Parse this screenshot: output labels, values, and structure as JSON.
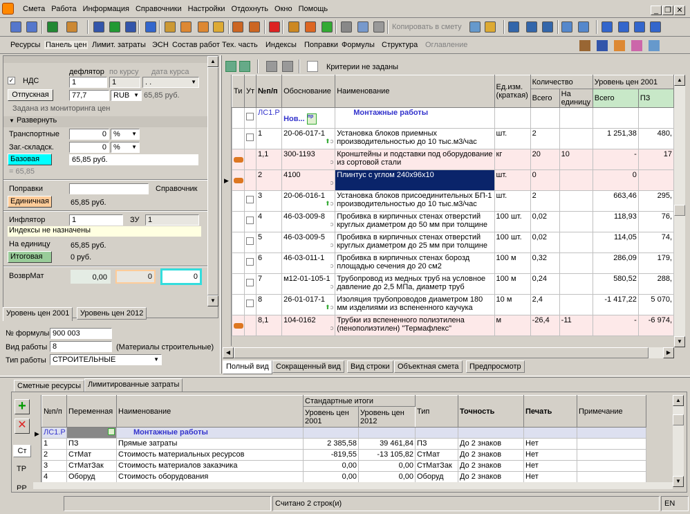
{
  "menu": [
    "Смета",
    "Работа",
    "Информация",
    "Справочники",
    "Настройки",
    "Отдохнуть",
    "Окно",
    "Помощь"
  ],
  "toolbar": {
    "copy_to_estimate": "Копировать в смету"
  },
  "toolbar_icons": [
    "add-row-icon",
    "insert-row-icon",
    "excel-icon",
    "find-icon",
    "save-icon",
    "refresh-icon",
    "undo-icon",
    "recalc-icon",
    "tools-icon",
    "people-icon",
    "house-icon",
    "comment-icon",
    "truck-icon",
    "bricks-icon",
    "delete-icon",
    "tree-icon",
    "move-down-icon",
    "move-up-icon",
    "cut-icon",
    "copy-icon",
    "paste-icon",
    "copy-left-icon",
    "copy-right-icon",
    "ls-icon",
    "r-icon",
    "pr-icon",
    "flag-icon",
    "flag2-icon",
    "indent-icon",
    "outdent-icon",
    "align-icon",
    "align2-icon"
  ],
  "nav_tabs": [
    "Ресурсы",
    "Панель цен",
    "Лимит. затраты",
    "ЭСН",
    "Состав работ",
    "Тех. часть",
    "Индексы",
    "Поправки",
    "Формулы",
    "Структура",
    "Оглавление"
  ],
  "left": {
    "nds_label": "НДС",
    "deflator_label": "дефлятор",
    "by_rate_label": "по курсу",
    "rate_date_label": "дата курса",
    "deflator_value": "1",
    "rate_value": "1",
    "rate_date_value": ". .",
    "otpusk_button": "Отпускная",
    "otpusk_value": "77,7",
    "currency": "RUB",
    "otpusk_sum": "65,85 руб.",
    "monitoring_note": "Задана из мониторинга цен",
    "expand_label": "Развернуть",
    "transport_label": "Транспортные",
    "transport_value": "0",
    "transport_unit": "%",
    "storage_label": "Заг.-складск.",
    "storage_value": "0",
    "storage_unit": "%",
    "base_button": "Базовая",
    "base_value": "65,85 руб.",
    "base_eq": "= 65,85",
    "corrections_label": "Поправки",
    "directory_label": "Справочник",
    "unit_button": "Единичная",
    "unit_value": "65,85 руб.",
    "inflator_label": "Инфлятор",
    "inflator_value": "1",
    "zu_label": "ЗУ",
    "zu_value": "1",
    "indices_note": "Индексы не назначены",
    "per_unit_label": "На единицу",
    "per_unit_value": "65,85 руб.",
    "total_button": "Итоговая",
    "total_value": "0 руб.",
    "vozvr_label": "ВозврМат",
    "vozvr_v1": "0,00",
    "vozvr_v2": "0",
    "vozvr_v3": "0",
    "level_tabs": [
      "Уровень цен 2001",
      "Уровень цен 2012"
    ],
    "formula_label": "№ формулы",
    "formula_value": "900 003",
    "worktype_label": "Вид работы",
    "worktype_value": "8",
    "worktype_desc": "(Материалы строительные)",
    "jobtype_label": "Тип работы",
    "jobtype_value": "СТРОИТЕЛЬНЫЕ"
  },
  "criteria": "Критерии не заданы",
  "grid": {
    "headers": {
      "ti": "Ти",
      "ut": "Ут",
      "num": "№п/п",
      "basis": "Обоснование",
      "name": "Наименование",
      "unit": "Ед.изм. (краткая)",
      "qty": "Количество",
      "qty_total": "Всего",
      "qty_per": "На единицу",
      "price": "Уровень цен 2001",
      "price_total": "Всего",
      "pz": "ПЗ"
    },
    "section": {
      "code": "ЛС1.Р",
      "basis": "Нов...",
      "title": "Монтажные работы"
    },
    "rows": [
      {
        "num": "1",
        "basis": "20-06-017-1",
        "name": "Установка блоков приемных производительностью до 10 тыс.м3/час",
        "unit": "шт.",
        "qty": "2",
        "per": "",
        "total": "1 251,38",
        "pz": "480,"
      },
      {
        "num": "1,1",
        "basis": "300-1193",
        "name": "Кронштейны и подставки под оборудование из сортовой стали",
        "unit": "кг",
        "qty": "20",
        "per": "10",
        "total": "-",
        "pz": "17"
      },
      {
        "num": "2",
        "basis": "4100",
        "name": "Плинтус с углом  240x96x10",
        "unit": "шт.",
        "qty": "0",
        "per": "",
        "total": "0",
        "pz": ""
      },
      {
        "num": "3",
        "basis": "20-06-016-1",
        "name": "Установка блоков присоединительных БП-1 производительностью до 10 тыс.м3/час",
        "unit": "шт.",
        "qty": "2",
        "per": "",
        "total": "663,46",
        "pz": "295,"
      },
      {
        "num": "4",
        "basis": "46-03-009-8",
        "name": "Пробивка в кирпичных стенах отверстий круглых диаметром до 50 мм при толщине",
        "unit": "100 шт.",
        "qty": "0,02",
        "per": "",
        "total": "118,93",
        "pz": "76,"
      },
      {
        "num": "5",
        "basis": "46-03-009-5",
        "name": "Пробивка в кирпичных стенах отверстий круглых диаметром до 25 мм при толщине",
        "unit": "100 шт.",
        "qty": "0,02",
        "per": "",
        "total": "114,05",
        "pz": "74,"
      },
      {
        "num": "6",
        "basis": "46-03-011-1",
        "name": "Пробивка в кирпичных стенах борозд площадью сечения до 20 см2",
        "unit": "100 м",
        "qty": "0,32",
        "per": "",
        "total": "286,09",
        "pz": "179,"
      },
      {
        "num": "7",
        "basis": "м12-01-105-1",
        "name": "Трубопровод из медных труб на условное давление до 2,5 МПа, диаметр труб",
        "unit": "100 м",
        "qty": "0,24",
        "per": "",
        "total": "580,52",
        "pz": "288,"
      },
      {
        "num": "8",
        "basis": "26-01-017-1",
        "name": "Изоляция трубопроводов диаметром 180 мм изделиями из вспененного каучука",
        "unit": "10 м",
        "qty": "2,4",
        "per": "",
        "total": "-1 417,22",
        "pz": "5 070,"
      },
      {
        "num": "8,1",
        "basis": "104-0162",
        "name": "Трубки из вспененного полиэтилена (пенополиэтилен) \"Термафлекс\"",
        "unit": "м",
        "qty": "-26,4",
        "per": "-11",
        "total": "-",
        "pz": "-6 974,"
      }
    ]
  },
  "view_tabs": [
    "Полный вид",
    "Сокращенный вид",
    "Вид строки",
    "Объектная смета",
    "Предпросмотр"
  ],
  "bottom_tabs": [
    "Сметные ресурсы",
    "Лимитированные затраты"
  ],
  "side_tabs": [
    "Ст",
    "ТР",
    "РР"
  ],
  "lim": {
    "headers": {
      "num": "№п/п",
      "var": "Переменная",
      "name": "Наименование",
      "std": "Стандартные итоги",
      "l2001": "Уровень цен 2001",
      "l2012": "Уровень цен 2012",
      "type": "Тип",
      "prec": "Точность",
      "print": "Печать",
      "note": "Примечание"
    },
    "section": {
      "code": "ЛС1.Р",
      "title": "Монтажные работы"
    },
    "rows": [
      {
        "num": "1",
        "var": "ПЗ",
        "name": "Прямые затраты",
        "v1": "2 385,58",
        "v2": "39 461,84",
        "type": "ПЗ",
        "prec": "До 2 знаков",
        "print": "Нет"
      },
      {
        "num": "2",
        "var": "СтМат",
        "name": "Стоимость материальных ресурсов",
        "v1": "-819,55",
        "v2": "-13 105,82",
        "type": "СтМат",
        "prec": "До 2 знаков",
        "print": "Нет"
      },
      {
        "num": "3",
        "var": "СтМатЗак",
        "name": "Стоимость материалов заказчика",
        "v1": "0,00",
        "v2": "0,00",
        "type": "СтМатЗак",
        "prec": "До 2 знаков",
        "print": "Нет"
      },
      {
        "num": "4",
        "var": "Оборуд",
        "name": "Стоимость оборудования",
        "v1": "0,00",
        "v2": "0,00",
        "type": "Оборуд",
        "prec": "До 2 знаков",
        "print": "Нет"
      }
    ]
  },
  "status": {
    "message": "Считано 2 строк(и)",
    "lang": "EN"
  },
  "colors": {
    "selection": "#0a246a",
    "pink_row": "#fde9e9",
    "cyan_button": "#00ffff",
    "orange_button": "#ffcc99",
    "green_button": "#99cc99",
    "section_text": "#3333cc"
  }
}
